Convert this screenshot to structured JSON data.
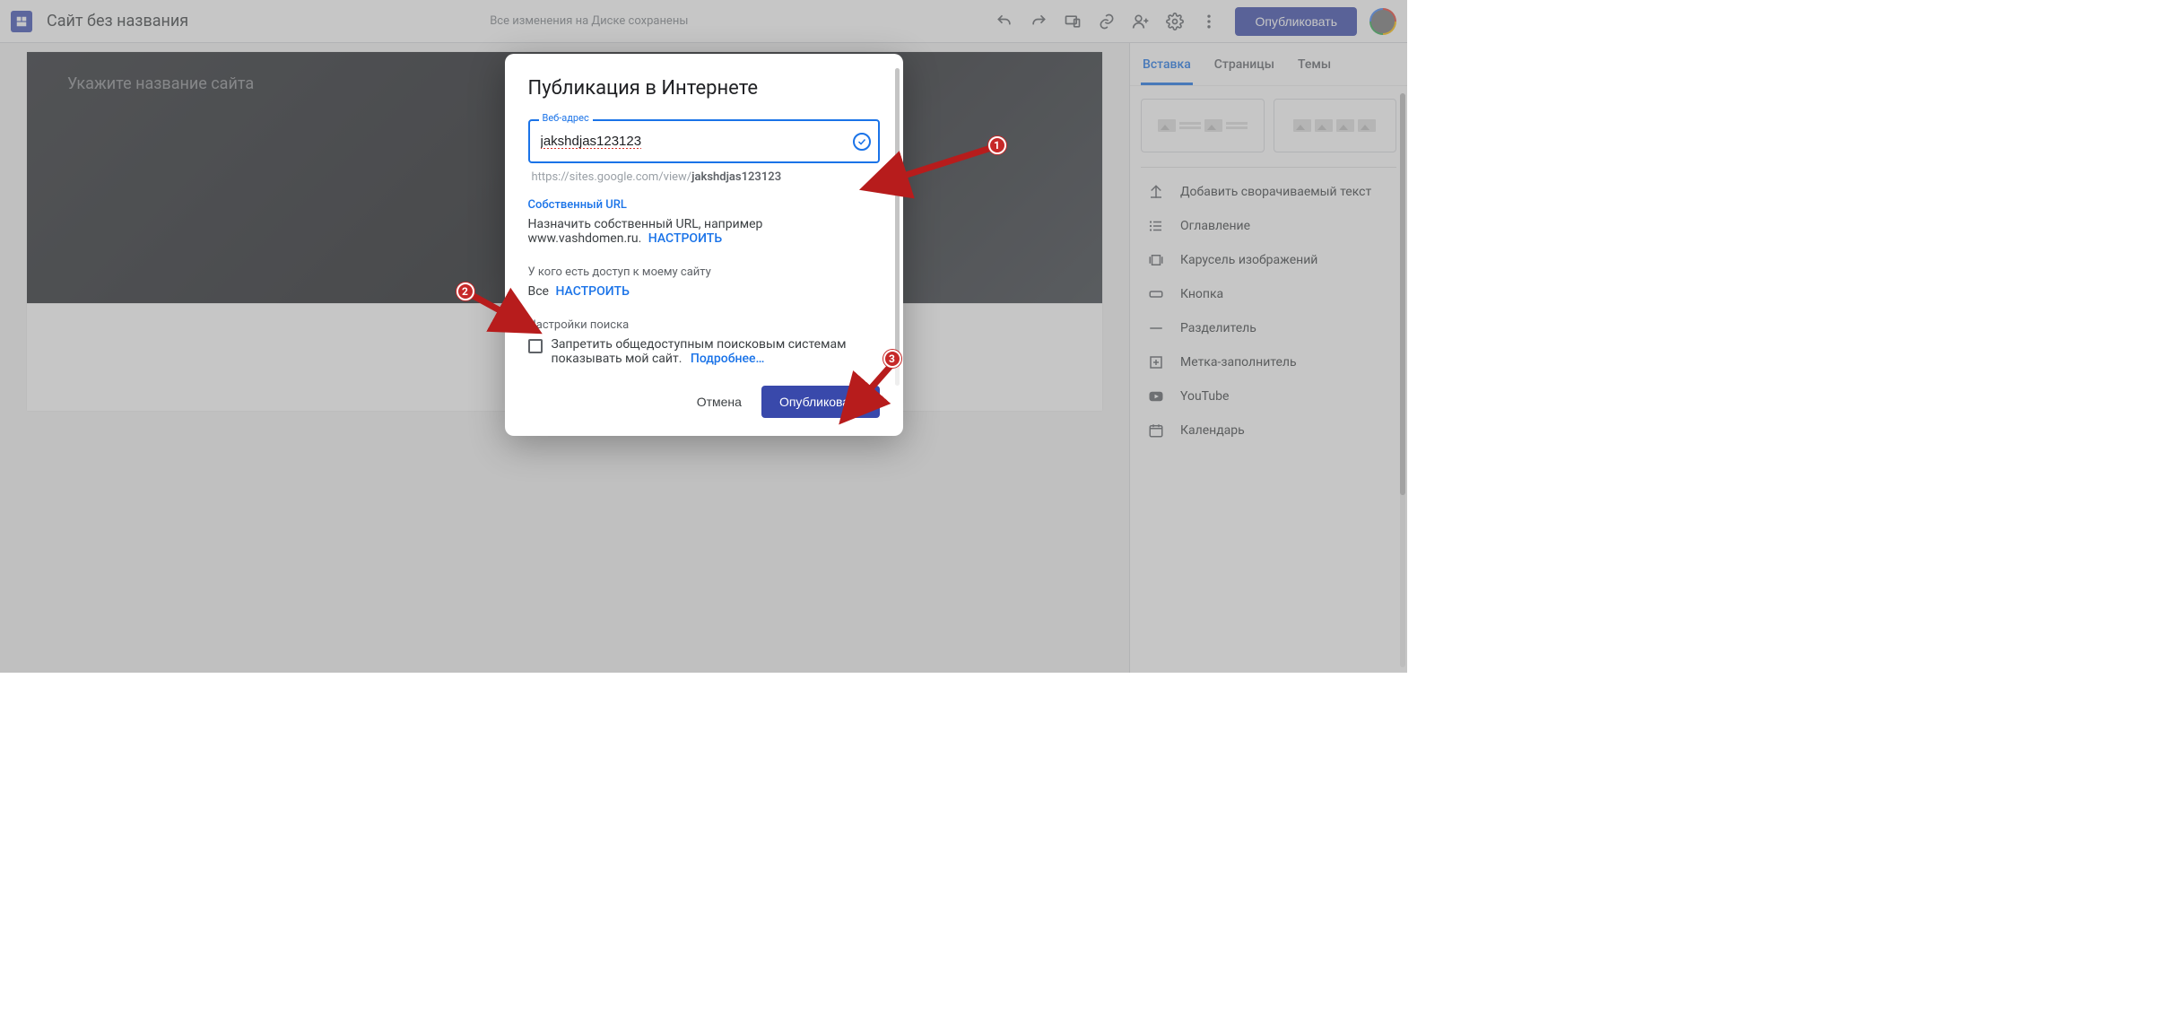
{
  "header": {
    "title": "Сайт без названия",
    "save_status": "Все изменения на Диске сохранены",
    "publish_label": "Опубликовать"
  },
  "canvas": {
    "hero_placeholder": "Укажите название сайта"
  },
  "right": {
    "tabs": {
      "insert": "Вставка",
      "pages": "Страницы",
      "themes": "Темы"
    },
    "items": [
      "Добавить сворачиваемый текст",
      "Оглавление",
      "Карусель изображений",
      "Кнопка",
      "Разделитель",
      "Метка-заполнитель",
      "YouTube",
      "Календарь"
    ]
  },
  "modal": {
    "title": "Публикация в Интернете",
    "field_label": "Веб-адрес",
    "url_value": "jakshdjas123123",
    "url_prefix": "https://sites.google.com/view/",
    "url_slug": "jakshdjas123123",
    "custom_url_title": "Собственный URL",
    "custom_url_text": "Назначить собственный URL, например www.vashdomen.ru.",
    "configure": "НАСТРОИТЬ",
    "access_title": "У кого есть доступ к моему сайту",
    "access_value": "Все",
    "search_title": "Настройки поиска",
    "search_text": "Запретить общедоступным поисковым системам показывать мой сайт.",
    "learn_more": "Подробнее…",
    "cancel": "Отмена",
    "publish": "Опубликовать"
  },
  "annotations": {
    "b1": "1",
    "b2": "2",
    "b3": "3"
  }
}
